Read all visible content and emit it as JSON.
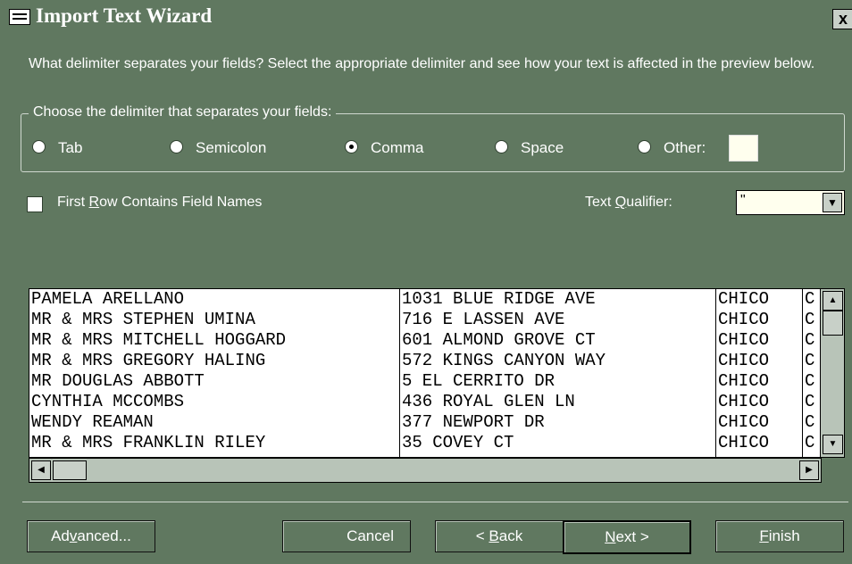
{
  "window": {
    "title": "Import Text Wizard",
    "close_glyph": "x"
  },
  "prompt": "What delimiter separates your fields?  Select the appropriate delimiter and see how your text is affected in the preview below.",
  "delimiter_group": {
    "legend": "Choose the delimiter that separates your fields:",
    "options": [
      {
        "label": "Tab",
        "selected": false
      },
      {
        "label": "Semicolon",
        "selected": false
      },
      {
        "label": "Comma",
        "selected": true
      },
      {
        "label": "Space",
        "selected": false
      },
      {
        "label": "Other:",
        "selected": false
      }
    ],
    "other_value": ""
  },
  "first_row": {
    "label_before": "First ",
    "label_accel": "R",
    "label_after": "ow Contains Field Names",
    "checked": false
  },
  "text_qualifier": {
    "label_before": "Text ",
    "label_accel": "Q",
    "label_after": "ualifier:",
    "value": "\""
  },
  "preview": {
    "columns": [
      [
        "PAMELA ARELLANO",
        "MR & MRS STEPHEN UMINA",
        "MR & MRS MITCHELL HOGGARD",
        "MR & MRS GREGORY HALING",
        "MR DOUGLAS ABBOTT",
        "CYNTHIA MCCOMBS",
        "WENDY REAMAN",
        "MR & MRS FRANKLIN RILEY"
      ],
      [
        "1031 BLUE RIDGE AVE",
        "716 E LASSEN AVE",
        "601 ALMOND GROVE CT",
        "572 KINGS CANYON WAY",
        "5 EL CERRITO DR",
        "436 ROYAL GLEN LN",
        "377 NEWPORT DR",
        "35 COVEY CT"
      ],
      [
        "CHICO",
        "CHICO",
        "CHICO",
        "CHICO",
        "CHICO",
        "CHICO",
        "CHICO",
        "CHICO"
      ],
      [
        "C",
        "C",
        "C",
        "C",
        "C",
        "C",
        "C",
        "C"
      ]
    ]
  },
  "buttons": {
    "advanced": {
      "before": "Ad",
      "accel": "v",
      "after": "anced..."
    },
    "cancel": {
      "label": "Cancel"
    },
    "back": {
      "before": "< ",
      "accel": "B",
      "after": "ack"
    },
    "next": {
      "before": "",
      "accel": "N",
      "after": "ext >"
    },
    "finish": {
      "before": "",
      "accel": "F",
      "after": "inish"
    }
  },
  "icons": {
    "window": "form-icon",
    "scroll_up": "up-arrow",
    "scroll_down": "down-arrow",
    "scroll_left": "left-arrow",
    "scroll_right": "right-arrow",
    "dropdown": "chevron-down"
  },
  "colors": {
    "window_bg": "#607860",
    "field_bg": "#ffffee",
    "text": "#ffffff"
  }
}
